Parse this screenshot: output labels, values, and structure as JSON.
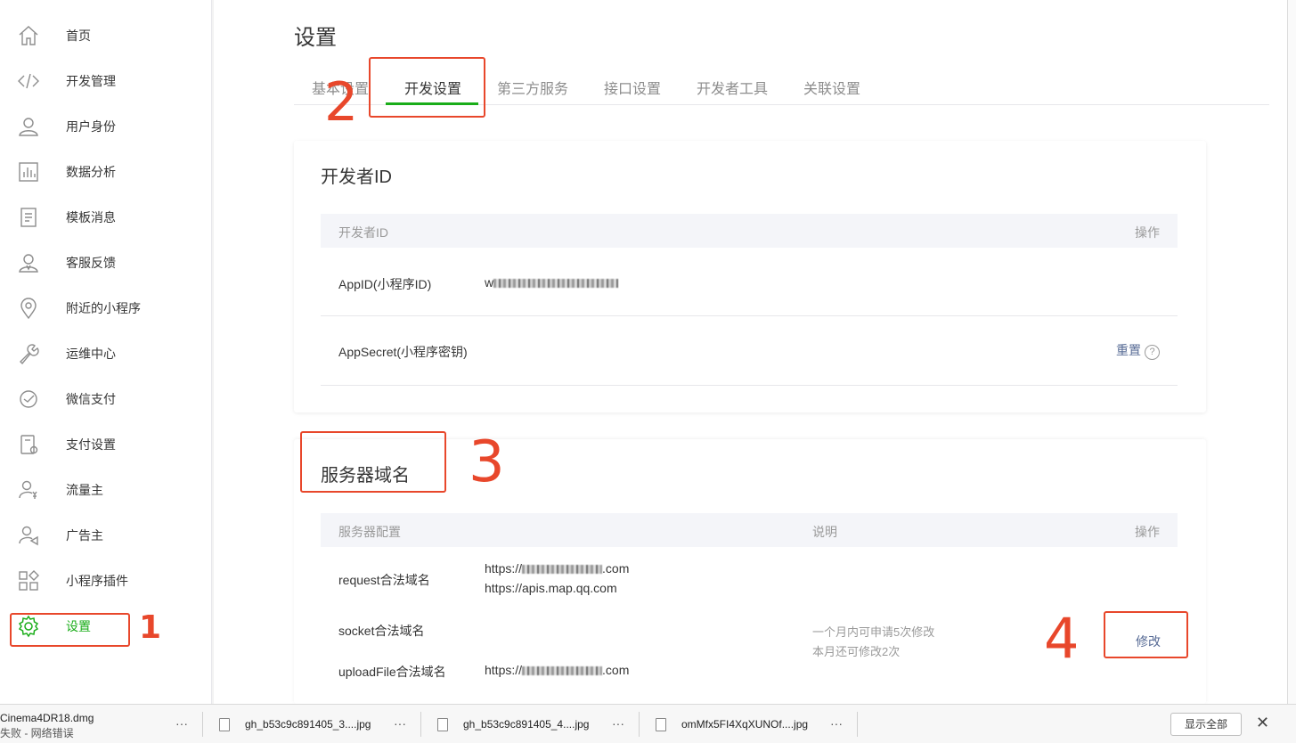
{
  "sidebar": {
    "items": [
      {
        "label": "首页",
        "icon": "home-icon"
      },
      {
        "label": "开发管理",
        "icon": "code-icon"
      },
      {
        "label": "用户身份",
        "icon": "user-icon"
      },
      {
        "label": "数据分析",
        "icon": "chart-icon"
      },
      {
        "label": "模板消息",
        "icon": "document-icon"
      },
      {
        "label": "客服反馈",
        "icon": "support-icon"
      },
      {
        "label": "附近的小程序",
        "icon": "location-icon"
      },
      {
        "label": "运维中心",
        "icon": "wrench-icon"
      },
      {
        "label": "微信支付",
        "icon": "payment-icon"
      },
      {
        "label": "支付设置",
        "icon": "payment-settings-icon"
      },
      {
        "label": "流量主",
        "icon": "traffic-owner-icon"
      },
      {
        "label": "广告主",
        "icon": "advertiser-icon"
      },
      {
        "label": "小程序插件",
        "icon": "plugin-icon"
      },
      {
        "label": "设置",
        "icon": "gear-icon",
        "active": true
      }
    ]
  },
  "page": {
    "title": "设置",
    "tabs": [
      "基本设置",
      "开发设置",
      "第三方服务",
      "接口设置",
      "开发者工具",
      "关联设置"
    ],
    "active_tab": "开发设置"
  },
  "developer_id": {
    "title": "开发者ID",
    "header_col1": "开发者ID",
    "header_action": "操作",
    "appid_label": "AppID(小程序ID)",
    "appid_value_prefix": "w",
    "appsecret_label": "AppSecret(小程序密钥)",
    "reset_link": "重置",
    "help_glyph": "?"
  },
  "server_domain": {
    "title": "服务器域名",
    "header_config": "服务器配置",
    "header_desc": "说明",
    "header_action": "操作",
    "request_label": "request合法域名",
    "request_domain1_prefix": "https://",
    "request_domain1_suffix": ".com",
    "request_domain2": "https://apis.map.qq.com",
    "socket_label": "socket合法域名",
    "desc_line1": "一个月内可申请5次修改",
    "desc_line2": "本月还可修改2次",
    "modify_button": "修改",
    "upload_label": "uploadFile合法域名",
    "upload_domain_prefix": "https://",
    "upload_domain_suffix": ".com"
  },
  "annotations": [
    "1",
    "2",
    "3",
    "4"
  ],
  "downloads": {
    "items": [
      {
        "name": "Cinema4DR18.dmg",
        "status": "失败 - 网络错误"
      },
      {
        "name": "gh_b53c9c891405_3....jpg"
      },
      {
        "name": "gh_b53c9c891405_4....jpg"
      },
      {
        "name": "omMfx5FI4XqXUNOf....jpg"
      }
    ],
    "more_glyph": "···",
    "show_all": "显示全部",
    "close_glyph": "✕"
  },
  "colors": {
    "accent": "#1aad19",
    "link": "#576b95",
    "annotation": "#e8472b"
  }
}
